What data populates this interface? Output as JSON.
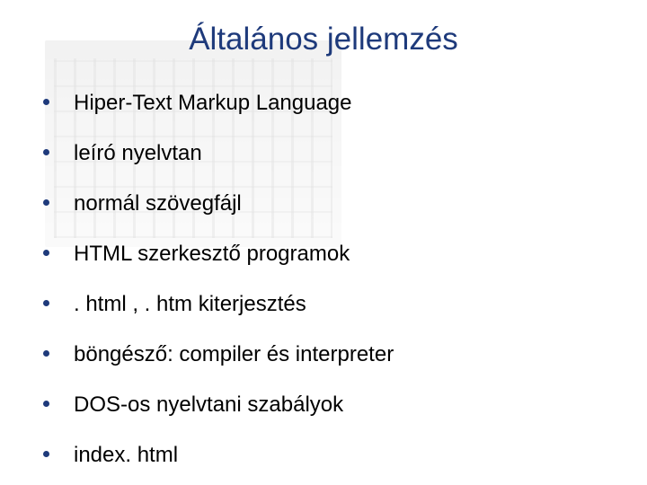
{
  "title": "Általános jellemzés",
  "bullets": [
    "Hiper-Text Markup Language",
    "leíró nyelvtan",
    "normál szövegfájl",
    "HTML szerkesztő programok",
    ". html , . htm kiterjesztés",
    "böngésző: compiler és interpreter",
    "DOS-os nyelvtani szabályok",
    "index. html"
  ]
}
